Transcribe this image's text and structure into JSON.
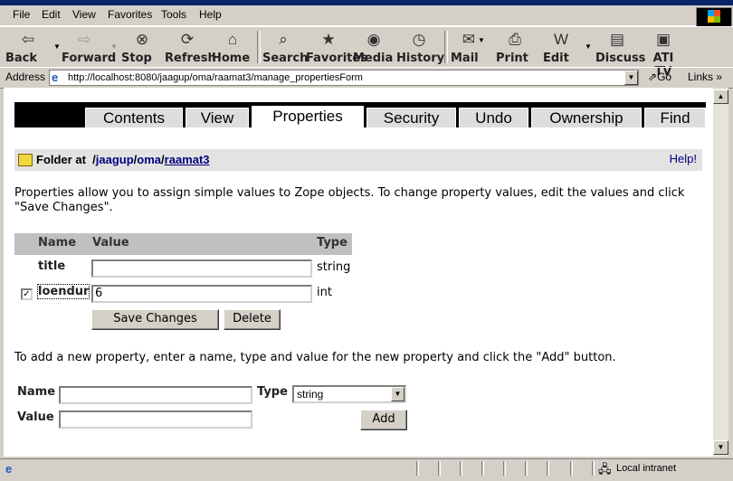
{
  "menu": {
    "items": [
      "File",
      "Edit",
      "View",
      "Favorites",
      "Tools",
      "Help"
    ]
  },
  "toolbar": {
    "back": "Back",
    "forward": "Forward",
    "stop": "Stop",
    "refresh": "Refresh",
    "home": "Home",
    "search": "Search",
    "favorites": "Favorites",
    "media": "Media",
    "history": "History",
    "mail": "Mail",
    "print": "Print",
    "edit": "Edit",
    "discuss": "Discuss",
    "ati_tv": "ATI TV"
  },
  "address": {
    "label": "Address",
    "url": "http://localhost:8080/jaagup/oma/raamat3/manage_propertiesForm",
    "go": "Go",
    "links": "Links"
  },
  "zope": {
    "tabs": [
      "Contents",
      "View",
      "Properties",
      "Security",
      "Undo",
      "Ownership",
      "Find"
    ],
    "active_tab": "Properties",
    "breadcrumb": {
      "prefix": "Folder at",
      "sep1": "/",
      "part1": "jaagup",
      "sep2": "/",
      "part2": "oma",
      "sep3": "/",
      "part3": "raamat3"
    },
    "help": "Help!",
    "intro": "Properties allow you to assign simple values to Zope objects. To change property values, edit the values and click \"Save Changes\".",
    "table": {
      "headers": {
        "name": "Name",
        "value": "Value",
        "type": "Type"
      },
      "rows": [
        {
          "name": "title",
          "value": "",
          "type": "string",
          "checked": false
        },
        {
          "name": "loendur",
          "value": "6",
          "type": "int",
          "checked": true
        }
      ]
    },
    "save_button": "Save Changes",
    "delete_button": "Delete",
    "add_intro": "To add a new property, enter a name, type and value for the new property and click the \"Add\" button.",
    "add_form": {
      "name_label": "Name",
      "name_value": "",
      "type_label": "Type",
      "type_value": "string",
      "value_label": "Value",
      "value_value": "",
      "add_button": "Add"
    }
  },
  "status": {
    "zone": "Local intranet"
  }
}
